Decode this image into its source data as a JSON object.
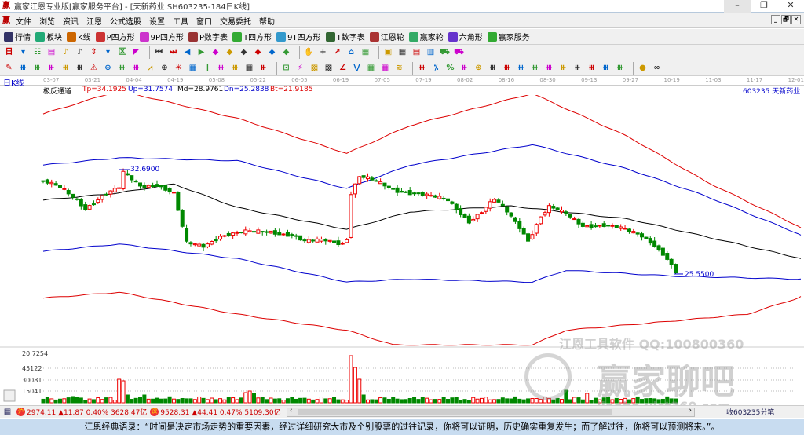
{
  "window": {
    "title": "赢家江恩专业版[赢家服务平台] - [天新药业  SH603235-184日K线]",
    "min": "–",
    "restore": "❐",
    "close": "✕"
  },
  "menu": [
    "文件",
    "浏览",
    "资讯",
    "江恩",
    "公式选股",
    "设置",
    "工具",
    "窗口",
    "交易委托",
    "帮助"
  ],
  "mdi": [
    "_",
    "🗗",
    "✕"
  ],
  "toolbar1": [
    {
      "label": "行情",
      "icon": "quote-grid-icon",
      "color": "#336"
    },
    {
      "label": "板块",
      "icon": "sector-blocks-icon",
      "color": "#2a7"
    },
    {
      "label": "K线",
      "icon": "kline-icon",
      "color": "#c60"
    },
    {
      "label": "P四方形",
      "icon": "ps-icon",
      "color": "#c33"
    },
    {
      "label": "9P四方形",
      "icon": "p9-icon",
      "color": "#c3c"
    },
    {
      "label": "P数字表",
      "icon": "pn-icon",
      "color": "#933"
    },
    {
      "label": "T四方形",
      "icon": "ts-icon",
      "color": "#3a3"
    },
    {
      "label": "9T四方形",
      "icon": "t9-icon",
      "color": "#39c"
    },
    {
      "label": "T数字表",
      "icon": "tn-icon",
      "color": "#363"
    },
    {
      "label": "江恩轮",
      "icon": "gann-wheel-icon",
      "color": "#a33"
    },
    {
      "label": "赢家轮",
      "icon": "winner-wheel-icon",
      "color": "#3a6"
    },
    {
      "label": "六角形",
      "icon": "hexagon-icon",
      "color": "#63c"
    },
    {
      "label": "赢家服务",
      "icon": "dollar-icon",
      "color": "#3a3"
    }
  ],
  "toolbar2": [
    "日",
    "▾",
    "☷",
    "▤",
    "♪",
    "♪",
    "⇕",
    "▾",
    "区",
    "◤",
    "|",
    "⏮",
    "⏭",
    "◀",
    "▶",
    "◆",
    "◆",
    "◆",
    "◆",
    "◆",
    "◆",
    "|",
    "✋",
    "+",
    "↗",
    "⌂",
    "▦",
    "|",
    "▣",
    "▦",
    "▤",
    "▥",
    "⛟",
    "⛟"
  ],
  "toolbar3": [
    "✎",
    "⧻",
    "⧻",
    "⧻",
    "⧻",
    "⧻",
    "⚠",
    "⊖",
    "⧻",
    "⧻",
    "⩘",
    "⊕",
    "✳",
    "▦",
    "∥",
    "⧻",
    "⧻",
    "▦",
    "⧻",
    "|",
    "⊡",
    "⚡",
    "▩",
    "▩",
    "∠",
    "⋁",
    "▦",
    "▦",
    "≋",
    "|",
    "⧻",
    "⁒",
    "%",
    "⧻",
    "⊛",
    "⧻",
    "⧻",
    "⧻",
    "⧻",
    "⧻",
    "⧻",
    "⧻",
    "⧻",
    "⧻",
    "⧻",
    "|",
    "●",
    "∞"
  ],
  "period_label": "日K线",
  "dates": [
    "03-07",
    "03-21",
    "04-04",
    "04-19",
    "05-08",
    "05-22",
    "06-05",
    "06-19",
    "07-05",
    "07-19",
    "08-02",
    "08-16",
    "08-30",
    "09-13",
    "09-27",
    "10-19",
    "11-03",
    "11-17",
    "12-01"
  ],
  "indicator": {
    "name": "极反通道",
    "tp": "Tp=34.1925",
    "up": "Up=31.7574",
    "md": "Md=28.9761",
    "dn": "Dn=25.2838",
    "bt": "Bt=21.9185"
  },
  "stock_label": "603235 天新药业",
  "chart_data": {
    "type": "candlestick",
    "title": "天新药业 SH603235 日K线",
    "price_range": [
      19,
      39
    ],
    "high_label": "32.6900",
    "low_label": "25.5500",
    "close_keypoints": [
      [
        0,
        31.9
      ],
      [
        4,
        31.4
      ],
      [
        8,
        30.6
      ],
      [
        10,
        30.1
      ],
      [
        14,
        30.9
      ],
      [
        18,
        31.4
      ],
      [
        19,
        32.4
      ],
      [
        23,
        31.6
      ],
      [
        27,
        31.7
      ],
      [
        31,
        31.0
      ],
      [
        33,
        28.7
      ],
      [
        34,
        27.6
      ],
      [
        38,
        27.5
      ],
      [
        42,
        28.2
      ],
      [
        46,
        28.3
      ],
      [
        49,
        28.4
      ],
      [
        54,
        28.5
      ],
      [
        59,
        28.2
      ],
      [
        62,
        27.7
      ],
      [
        67,
        27.9
      ],
      [
        71,
        27.7
      ],
      [
        72,
        28.0
      ],
      [
        73,
        31.1
      ],
      [
        75,
        32.2
      ],
      [
        78,
        31.9
      ],
      [
        81,
        31.6
      ],
      [
        84,
        31.3
      ],
      [
        88,
        31.1
      ],
      [
        92,
        30.8
      ],
      [
        96,
        30.6
      ],
      [
        101,
        29.2
      ],
      [
        104,
        29.8
      ],
      [
        107,
        30.6
      ],
      [
        110,
        29.8
      ],
      [
        113,
        28.8
      ],
      [
        115,
        27.9
      ],
      [
        118,
        29.5
      ],
      [
        120,
        30.1
      ],
      [
        124,
        29.6
      ],
      [
        128,
        28.9
      ],
      [
        133,
        28.9
      ],
      [
        137,
        28.6
      ],
      [
        142,
        28.2
      ],
      [
        145,
        27.6
      ],
      [
        148,
        26.6
      ],
      [
        150,
        25.6
      ]
    ],
    "bands": {
      "tp": [
        [
          0,
          36.5
        ],
        [
          18,
          38.1
        ],
        [
          46,
          36.2
        ],
        [
          72,
          33.8
        ],
        [
          87,
          35.7
        ],
        [
          116,
          37.9
        ],
        [
          139,
          34.9
        ],
        [
          157,
          31.9
        ],
        [
          180,
          28.7
        ]
      ],
      "up": [
        [
          0,
          33.0
        ],
        [
          18,
          33.5
        ],
        [
          46,
          33.3
        ],
        [
          72,
          31.4
        ],
        [
          87,
          33.0
        ],
        [
          116,
          34.4
        ],
        [
          139,
          32.7
        ],
        [
          157,
          30.9
        ],
        [
          180,
          28.2
        ]
      ],
      "md": [
        [
          0,
          30.6
        ],
        [
          18,
          31.1
        ],
        [
          31,
          31.7
        ],
        [
          46,
          30.1
        ],
        [
          72,
          28.6
        ],
        [
          87,
          29.8
        ],
        [
          111,
          30.2
        ],
        [
          139,
          29.3
        ],
        [
          180,
          26.6
        ]
      ],
      "dn": [
        [
          0,
          27.1
        ],
        [
          18,
          27.6
        ],
        [
          46,
          26.6
        ],
        [
          72,
          25.0
        ],
        [
          87,
          25.2
        ],
        [
          116,
          25.0
        ],
        [
          124,
          25.8
        ],
        [
          150,
          25.4
        ],
        [
          180,
          25.2
        ]
      ],
      "bt": [
        [
          0,
          23.9
        ],
        [
          18,
          24.3
        ],
        [
          46,
          22.8
        ],
        [
          72,
          21.7
        ],
        [
          83,
          20.7
        ],
        [
          116,
          20.7
        ],
        [
          124,
          21.7
        ],
        [
          148,
          22.3
        ],
        [
          167,
          22.8
        ],
        [
          180,
          24.0
        ]
      ]
    },
    "volume": {
      "axis_labels": [
        "20.7254",
        "45122",
        "30081",
        "15041"
      ],
      "max": 65000,
      "base": 5500,
      "spikes": [
        [
          7,
          8000
        ],
        [
          18,
          30000
        ],
        [
          19,
          28000
        ],
        [
          20,
          10000
        ],
        [
          24,
          10000
        ],
        [
          48,
          13000
        ],
        [
          49,
          15000
        ],
        [
          50,
          12000
        ],
        [
          73,
          60000
        ],
        [
          74,
          45000
        ],
        [
          75,
          30000
        ],
        [
          76,
          10000
        ],
        [
          124,
          16000
        ],
        [
          129,
          12000
        ],
        [
          158,
          10000
        ],
        [
          164,
          11000
        ],
        [
          165,
          10000
        ],
        [
          167,
          9000
        ]
      ]
    }
  },
  "watermark": {
    "line1": "江恩工具软件  QQ:100800360",
    "line2": "赢家聊吧",
    "line3": "liaoba.yict360.com"
  },
  "status": {
    "sh_badge": "沪",
    "sh": "2974.11 ▲11.87 0.40% 3628.47亿",
    "sz_badge": "深",
    "sz": "9528.31 ▲44.41 0.47% 5109.30亿",
    "scroll_left": "‹",
    "scroll_right": "›",
    "right": "收603235分笔"
  },
  "quote": "江恩经典语录：“时间是决定市场走势的重要因素，经过详细研究大市及个别股票的过往记录，你将可以证明，历史确实重复发生；而了解过往，你将可以预测将来。”。"
}
